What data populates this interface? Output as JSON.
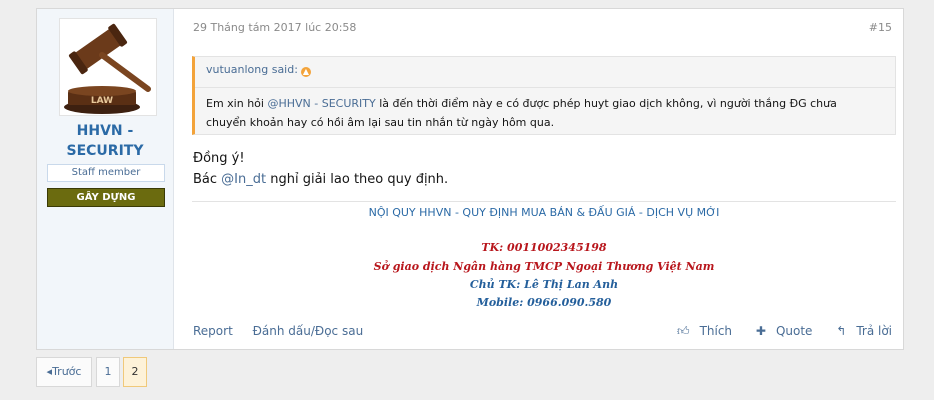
{
  "post": {
    "date": "29 Tháng tám 2017 lúc 20:58",
    "number": "#15",
    "user": {
      "name_line1": "HHVN -",
      "name_line2": "SECURITY",
      "title": "Staff member",
      "banner": "GÂY DỰNG",
      "avatar_text": "LAW"
    },
    "quote": {
      "author": "vutuanlong said:",
      "text_before": "Em xin hỏi ",
      "mention": "@HHVN - SECURITY",
      "text_line1_after": " là đến thời điểm này e có được phép huyt giao dịch không, vì người thắng ĐG chưa",
      "text_line2": "chuyển khoản hay có hồi âm lại sau tin nhắn từ ngày hôm qua."
    },
    "message": {
      "line1": "Đồng ý!",
      "line2_before": "Bác ",
      "mention": "@In_dt",
      "line2_after": " nghỉ giải lao theo quy định."
    },
    "signature": {
      "link": "NỘI QUY HHVN - QUY ĐỊNH MUA BÁN & ĐẤU GIÁ - DỊCH VỤ MỚI",
      "account": "TK: 0011002345198",
      "bank": "Sở giao dịch Ngân hàng TMCP Ngoại Thương Việt Nam",
      "owner": "Chủ TK: Lê Thị Lan Anh",
      "mobile": "Mobile: 0966.090.580"
    },
    "actions": {
      "report": "Report",
      "bookmark": "Đánh dấu/Đọc sau",
      "like": "Thích",
      "quote": "Quote",
      "reply": "Trả lời"
    }
  },
  "pagination": {
    "prev": "Trước",
    "pages": [
      "1",
      "2"
    ],
    "current": "2"
  },
  "colors": {
    "accent": "#2b6aa6",
    "quote_border": "#f3a33a",
    "banner": "#6b6b0f",
    "signature_red": "#b8161c"
  }
}
